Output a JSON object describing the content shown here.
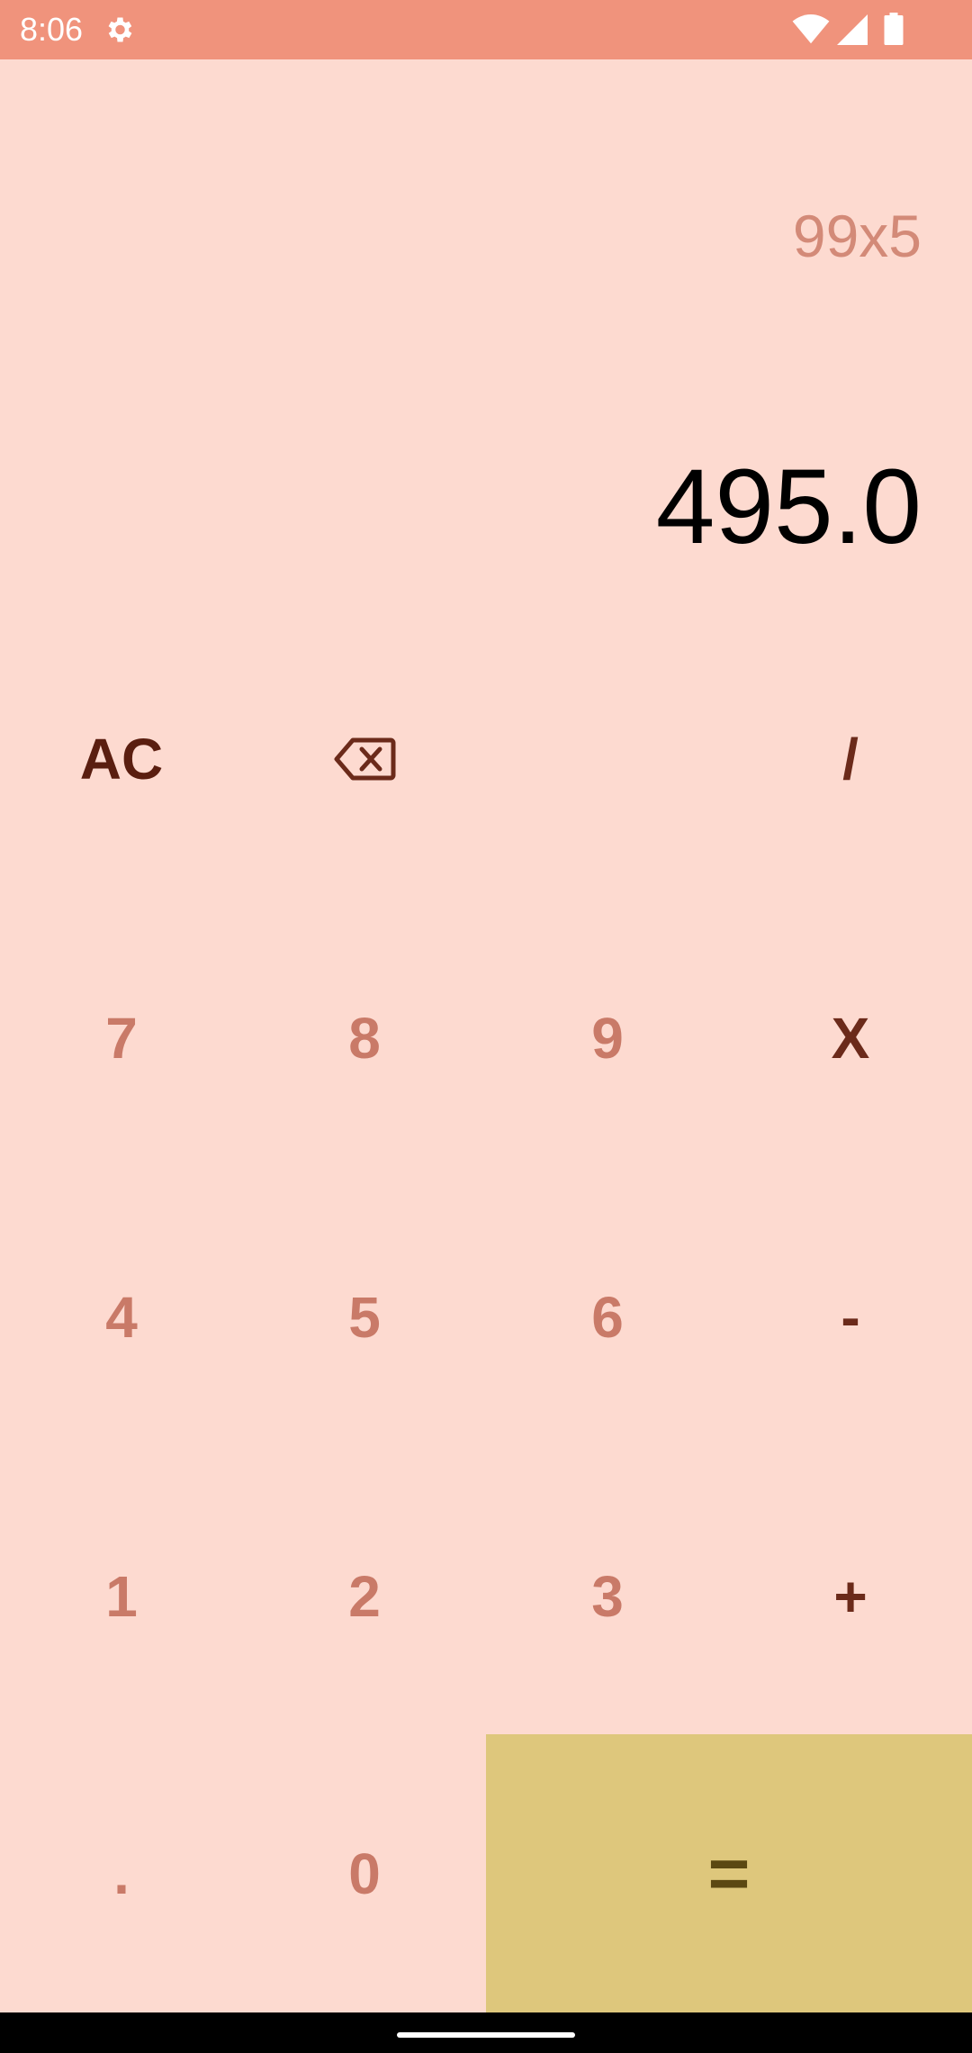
{
  "status_bar": {
    "time": "8:06",
    "icons": [
      "gear-icon",
      "wifi-icon",
      "signal-icon",
      "battery-icon"
    ],
    "color": "#F0937C"
  },
  "display": {
    "expression": "99x5",
    "result": "495.0"
  },
  "keypad": {
    "row1": {
      "ac": "AC",
      "backspace_icon": "backspace-icon",
      "divide": "/"
    },
    "row2": {
      "k7": "7",
      "k8": "8",
      "k9": "9",
      "multiply": "X"
    },
    "row3": {
      "k4": "4",
      "k5": "5",
      "k6": "6",
      "subtract": "-"
    },
    "row4": {
      "k1": "1",
      "k2": "2",
      "k3": "3",
      "add": "+"
    },
    "row5": {
      "dot": ".",
      "k0": "0",
      "equals": "="
    }
  },
  "colors": {
    "background": "#FDDAD0",
    "digit": "#C97A68",
    "operator": "#6B2A1A",
    "equals_bg": "#DEC77C",
    "equals_fg": "#5B4812"
  }
}
